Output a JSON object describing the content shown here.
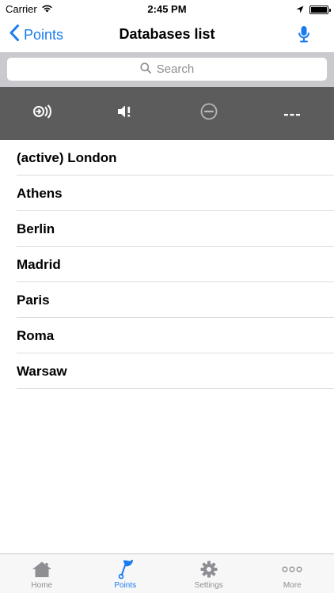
{
  "status_bar": {
    "carrier": "Carrier",
    "time": "2:45 PM"
  },
  "nav": {
    "back_label": "Points",
    "title": "Databases list"
  },
  "search": {
    "placeholder": "Search"
  },
  "toolbar": {
    "buttons": [
      "broadcast-icon",
      "speaker-alert-icon",
      "minus-circle-icon",
      "more-dots-icon"
    ]
  },
  "databases": [
    {
      "label": "(active) London"
    },
    {
      "label": "Athens"
    },
    {
      "label": "Berlin"
    },
    {
      "label": "Madrid"
    },
    {
      "label": "Paris"
    },
    {
      "label": "Roma"
    },
    {
      "label": "Warsaw"
    }
  ],
  "tabs": [
    {
      "label": "Home",
      "icon": "home-icon"
    },
    {
      "label": "Points",
      "icon": "flag-icon",
      "active": true
    },
    {
      "label": "Settings",
      "icon": "gear-icon"
    },
    {
      "label": "More",
      "icon": "more-icon"
    }
  ],
  "colors": {
    "accent": "#1a7bf0",
    "toolbar_bg": "#5c5c5c",
    "search_bg": "#c9c9ce",
    "separator": "#dcdcdc"
  }
}
